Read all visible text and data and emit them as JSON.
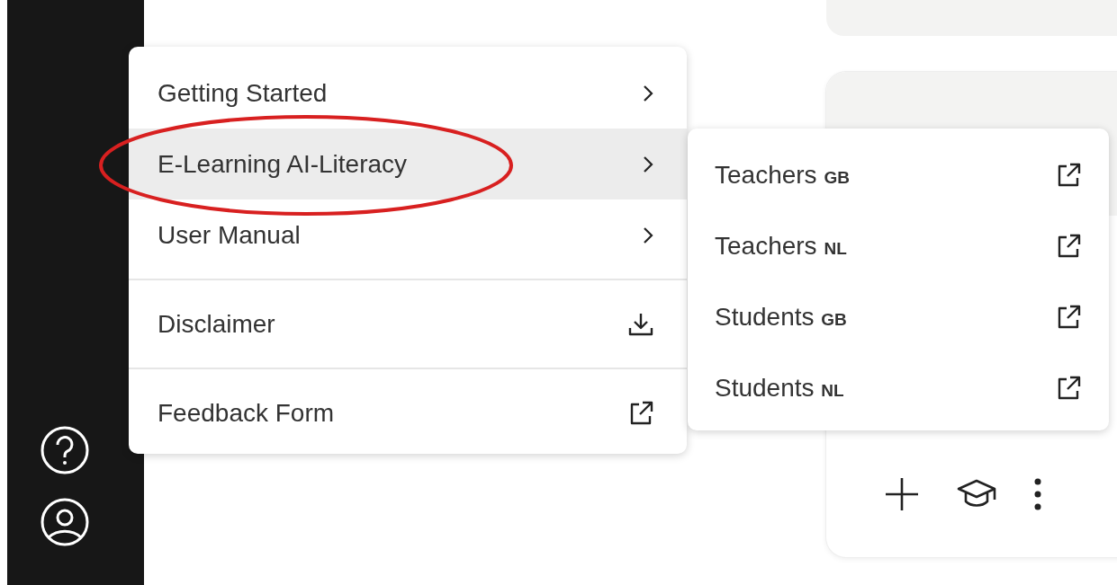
{
  "menu": {
    "groups": [
      {
        "items": [
          {
            "label": "Getting Started",
            "kind": "submenu",
            "selected": false
          },
          {
            "label": "E-Learning AI-Literacy",
            "kind": "submenu",
            "selected": true
          },
          {
            "label": "User Manual",
            "kind": "submenu",
            "selected": false
          }
        ]
      },
      {
        "items": [
          {
            "label": "Disclaimer",
            "kind": "download",
            "selected": false
          }
        ]
      },
      {
        "items": [
          {
            "label": "Feedback Form",
            "kind": "external",
            "selected": false
          }
        ]
      }
    ]
  },
  "submenu": {
    "items": [
      {
        "label": "Teachers",
        "region": "GB",
        "kind": "external"
      },
      {
        "label": "Teachers",
        "region": "NL",
        "kind": "external"
      },
      {
        "label": "Students",
        "region": "GB",
        "kind": "external"
      },
      {
        "label": "Students",
        "region": "NL",
        "kind": "external"
      }
    ]
  },
  "annotation": {
    "kind": "ellipse"
  }
}
